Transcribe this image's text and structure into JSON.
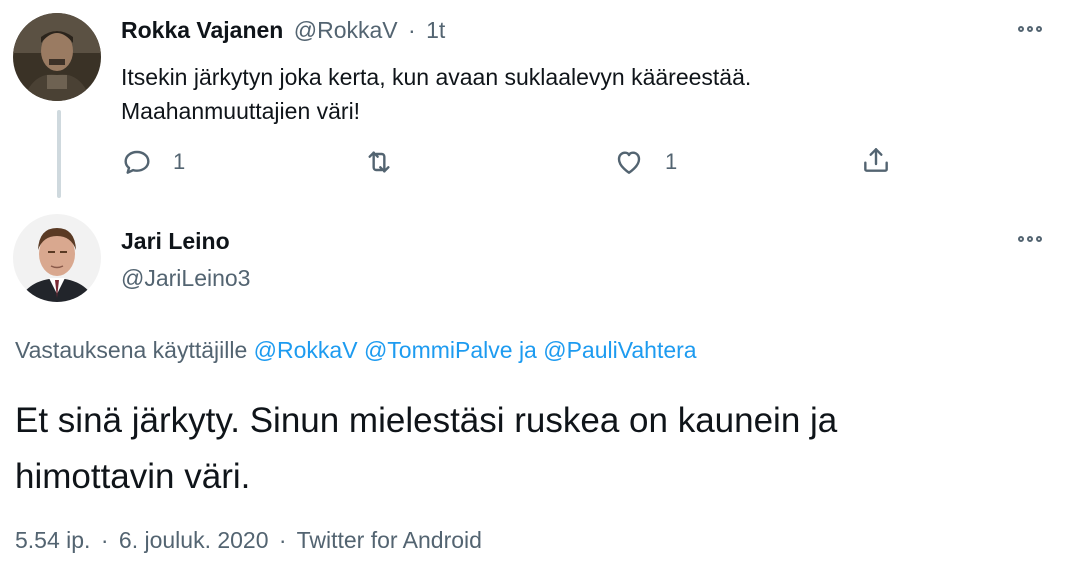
{
  "reply_tweet": {
    "name": "Rokka Vajanen",
    "handle": "@RokkaV",
    "separator": "·",
    "time": "1t",
    "text_line1": "Itsekin järkytyn joka kerta, kun avaan suklaalevyn kääreestää.",
    "text_line2": "Maahanmuuttajien väri!",
    "reply_count": "1",
    "like_count": "1",
    "icons": [
      "reply-icon",
      "retweet-icon",
      "like-icon",
      "share-icon",
      "more-icon"
    ]
  },
  "main_tweet": {
    "name": "Jari Leino",
    "handle": "@JariLeino3",
    "replying_prefix": "Vastauksena käyttäjille",
    "mention1": "@RokkaV",
    "mention2": "@TommiPalve",
    "mention_joiner": "ja",
    "mention3": "@PauliVahtera",
    "text_line1": "Et sinä järkyty. Sinun mielestäsi ruskea on kaunein ja",
    "text_line2": "himottavin väri.",
    "time": "5.54 ip.",
    "dot": "·",
    "date": "6. jouluk. 2020",
    "source": "Twitter for Android"
  },
  "colors": {
    "text": "#0f1419",
    "muted": "#536471",
    "link": "#1d9bf0",
    "thread_line": "#cfd9de"
  }
}
